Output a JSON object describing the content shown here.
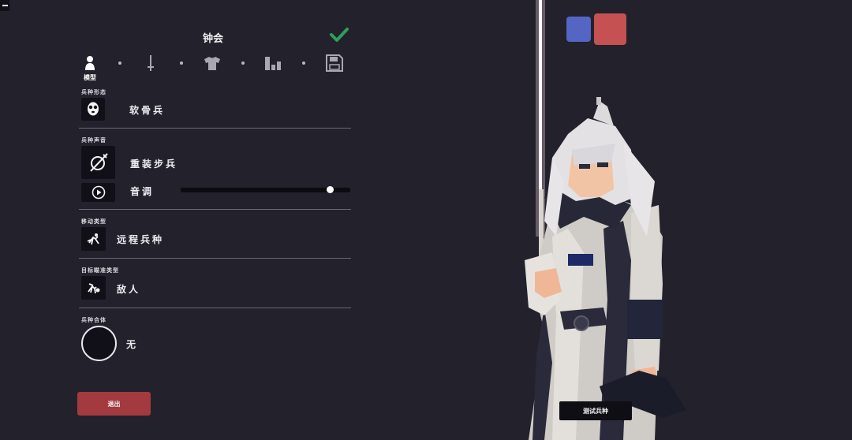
{
  "unit_name": "钟会",
  "tabs": [
    {
      "name": "model",
      "icon": "person-icon",
      "label": "模型"
    },
    {
      "name": "weapon",
      "icon": "sword-icon",
      "label": ""
    },
    {
      "name": "clothing",
      "icon": "shirt-icon",
      "label": ""
    },
    {
      "name": "stats",
      "icon": "bar-chart-icon",
      "label": ""
    },
    {
      "name": "save",
      "icon": "floppy-disk-icon",
      "label": ""
    }
  ],
  "sections": {
    "unit_base": {
      "label": "兵种形态",
      "value": "软骨兵",
      "icon": "skull-mask-icon"
    },
    "unit_voice": {
      "label": "兵种声音",
      "value": "重装步兵",
      "icon": "sword-shield-icon",
      "pitch_label": "音调",
      "play_icon": "play-icon",
      "pitch": 0.88
    },
    "movement": {
      "label": "移动类型",
      "value": "远程兵种",
      "icon": "movement-icon"
    },
    "targeting": {
      "label": "目标瞄准类型",
      "value": "敌人",
      "icon": "target-icon"
    },
    "merge": {
      "label": "兵种合体",
      "value": "无"
    }
  },
  "buttons": {
    "exit": "退出",
    "test_unit": "测试兵种"
  },
  "team_colors": {
    "blue": "#5565c4",
    "red": "#c55152"
  },
  "accent": {
    "checkmark": "#2f9e5a"
  }
}
